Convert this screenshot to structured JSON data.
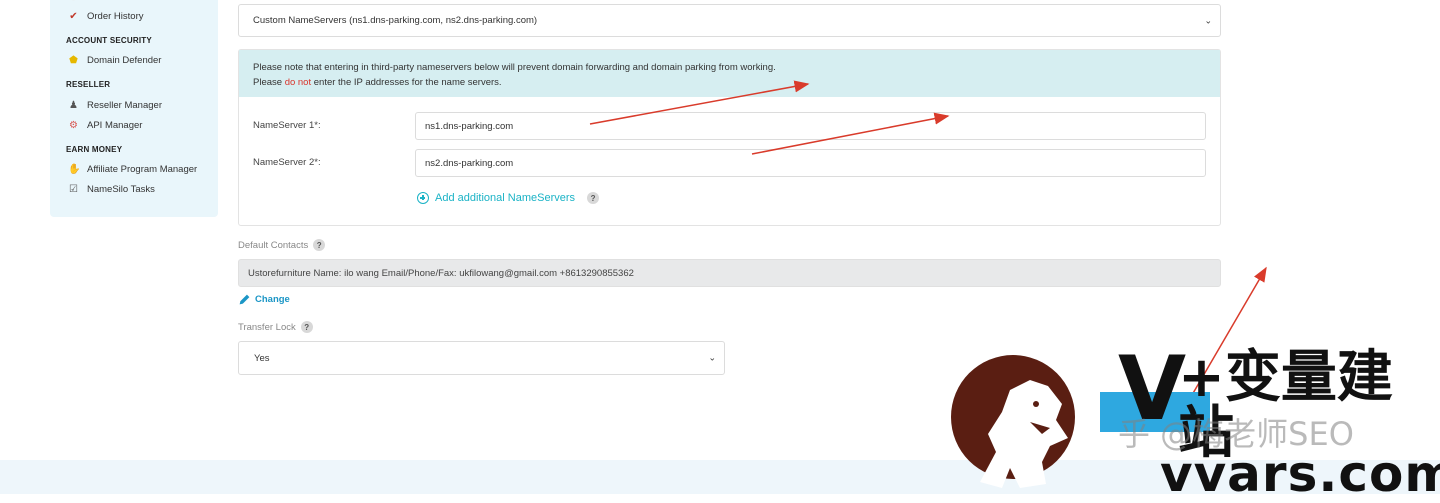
{
  "sidebar": {
    "order_history": "Order History",
    "account_security_heading": "ACCOUNT SECURITY",
    "domain_defender": "Domain Defender",
    "reseller_heading": "RESELLER",
    "reseller_manager": "Reseller Manager",
    "api_manager": "API Manager",
    "earn_money_heading": "EARN MONEY",
    "affiliate_program_manager": "Affiliate Program Manager",
    "namesilo_tasks": "NameSilo Tasks"
  },
  "nameserver_select": {
    "value": "Custom NameServers (ns1.dns-parking.com, ns2.dns-parking.com)"
  },
  "alert": {
    "line1": "Please note that entering in third-party nameservers below will prevent domain forwarding and domain parking from working.",
    "line2_prefix": "Please ",
    "line2_danger": "do not",
    "line2_suffix": " enter the IP addresses for the name servers."
  },
  "nameservers": [
    {
      "label": "NameServer 1*:",
      "value": "ns1.dns-parking.com"
    },
    {
      "label": "NameServer 2*:",
      "value": "ns2.dns-parking.com"
    }
  ],
  "add_nameservers_label": "Add additional NameServers",
  "help_glyph": "?",
  "default_contacts": {
    "label": "Default Contacts",
    "value": "Ustorefurniture Name: ilo wang Email/Phone/Fax: ukfilowang@gmail.com +8613290855362",
    "change_label": "Change"
  },
  "transfer_lock": {
    "label": "Transfer Lock",
    "value": "Yes"
  },
  "watermark": {
    "brand_letter": "V",
    "brand_cn": "+变量建站",
    "zhihu_text": "乎 @梅老师SEO",
    "url": "vvars.com"
  },
  "colors": {
    "accent": "#1bb3c6",
    "link": "#1b96c6",
    "danger": "#d9342b",
    "alert_bg": "#d6eef1",
    "sidebar_bg": "#e9f6fb",
    "arrow": "#d93b2b",
    "logo_brown": "#5a1e12"
  }
}
